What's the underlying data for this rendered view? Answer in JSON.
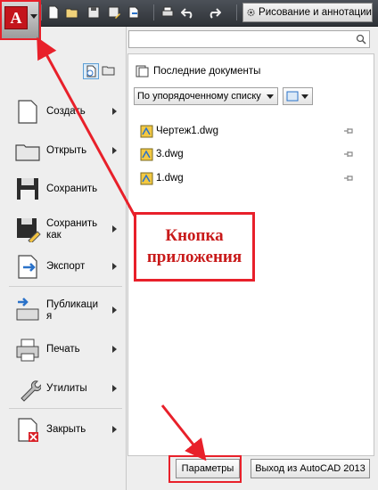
{
  "toolbar": {
    "workspace_label": "Рисование и аннотации",
    "quick_access_icons": [
      "new-icon",
      "open-icon",
      "save-icon",
      "save-as-icon",
      "publish-icon",
      "plot-icon",
      "undo-icon",
      "redo-icon"
    ]
  },
  "menu": {
    "items": [
      {
        "label": "Создать",
        "icon": "new-document-icon",
        "has_submenu": true
      },
      {
        "label": "Открыть",
        "icon": "open-folder-icon",
        "has_submenu": true
      },
      {
        "label": "Сохранить",
        "icon": "floppy-disk-icon",
        "has_submenu": false
      },
      {
        "label": "Сохранить\nкак",
        "icon": "save-as-icon",
        "has_submenu": true
      },
      {
        "label": "Экспорт",
        "icon": "export-icon",
        "has_submenu": true
      },
      {
        "label": "Публикаци\nя",
        "icon": "publish-icon",
        "has_submenu": true
      },
      {
        "label": "Печать",
        "icon": "printer-icon",
        "has_submenu": true
      },
      {
        "label": "Утилиты",
        "icon": "wrench-icon",
        "has_submenu": true
      },
      {
        "label": "Закрыть",
        "icon": "close-document-icon",
        "has_submenu": true
      }
    ]
  },
  "recent": {
    "header": "Последние документы",
    "sort_selected": "По упорядоченному списку",
    "files": [
      "Чертеж1.dwg",
      "3.dwg",
      "1.dwg"
    ]
  },
  "annotation": {
    "text": "Кнопка\nприложения",
    "color": "#e8202a"
  },
  "footer": {
    "options_label": "Параметры",
    "exit_label": "Выход из AutoCAD 2013"
  },
  "app_logo_letter": "A",
  "accent_color": "#c4151c"
}
